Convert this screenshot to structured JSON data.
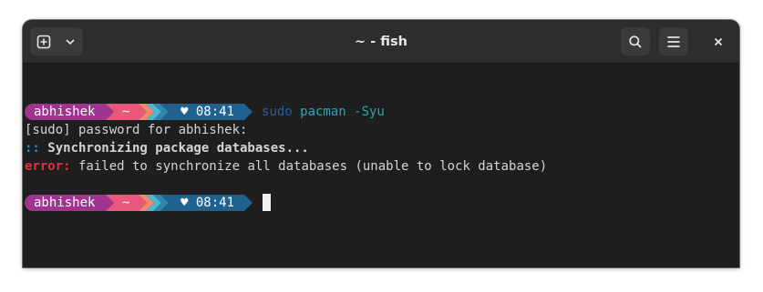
{
  "window": {
    "title": "~ - fish"
  },
  "header": {
    "new_tab_icon": "new-tab-icon",
    "dropdown_icon": "chevron-down-icon",
    "search_icon": "search-icon",
    "menu_icon": "hamburger-menu-icon",
    "close_icon": "close-icon"
  },
  "prompt": {
    "user": "abhishek",
    "dir": "~",
    "time": "♥ 08:41"
  },
  "terminal": {
    "command_sudo": "sudo",
    "command_rest": " pacman -Syu",
    "line_password": "[sudo] password for abhishek:",
    "line_sync_marker": "::",
    "line_sync_text": " Synchronizing package databases...",
    "line_error_label": "error:",
    "line_error_text": " failed to synchronize all databases (unable to lock database)"
  },
  "colors": {
    "user_segment": "#a1348f",
    "dir_segment": "#e8587a",
    "time_segment": "#1f628f",
    "accent_cyan": "#2aa5b8",
    "error_red": "#e5313c"
  }
}
